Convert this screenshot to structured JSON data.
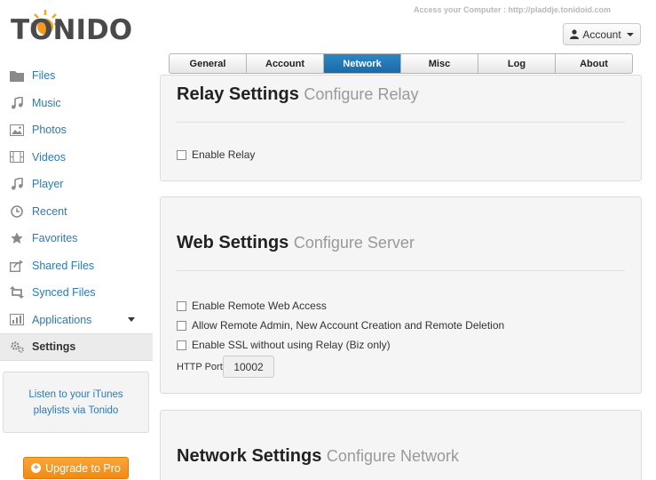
{
  "header": {
    "logo_text": "TONIDO",
    "access_url": "Access your Computer : http://pladdje.tonidoid.com",
    "account_label": "Account"
  },
  "tabs": [
    {
      "label": "General",
      "active": false
    },
    {
      "label": "Account",
      "active": false
    },
    {
      "label": "Network",
      "active": true
    },
    {
      "label": "Misc",
      "active": false
    },
    {
      "label": "Log",
      "active": false
    },
    {
      "label": "About",
      "active": false
    }
  ],
  "sidebar": {
    "items": [
      {
        "label": "Files",
        "icon": "folder-icon"
      },
      {
        "label": "Music",
        "icon": "music-icon"
      },
      {
        "label": "Photos",
        "icon": "photo-icon"
      },
      {
        "label": "Videos",
        "icon": "film-icon"
      },
      {
        "label": "Player",
        "icon": "player-icon"
      },
      {
        "label": "Recent",
        "icon": "clock-icon"
      },
      {
        "label": "Favorites",
        "icon": "star-icon"
      },
      {
        "label": "Shared Files",
        "icon": "share-icon"
      },
      {
        "label": "Synced Files",
        "icon": "sync-icon"
      },
      {
        "label": "Applications",
        "icon": "chart-icon"
      },
      {
        "label": "Settings",
        "icon": "gear-icon"
      }
    ],
    "promo_text": "Listen to your iTunes playlists via Tonido",
    "upgrade_label": "Upgrade to Pro"
  },
  "relay": {
    "title": "Relay Settings",
    "subtitle": "Configure Relay",
    "enable_relay": "Enable Relay"
  },
  "web": {
    "title": "Web Settings",
    "subtitle": "Configure Server",
    "options": [
      "Enable Remote Web Access",
      "Allow Remote Admin, New Account Creation and Remote Deletion",
      "Enable SSL without using Relay (Biz only)"
    ],
    "port_label": "HTTP Port:",
    "port_value": "10002"
  },
  "network": {
    "title": "Network Settings",
    "subtitle": "Configure Network"
  },
  "colors": {
    "accent": "#1a6aa8",
    "link": "#2a7ab8",
    "upgrade": "#f28a10"
  }
}
